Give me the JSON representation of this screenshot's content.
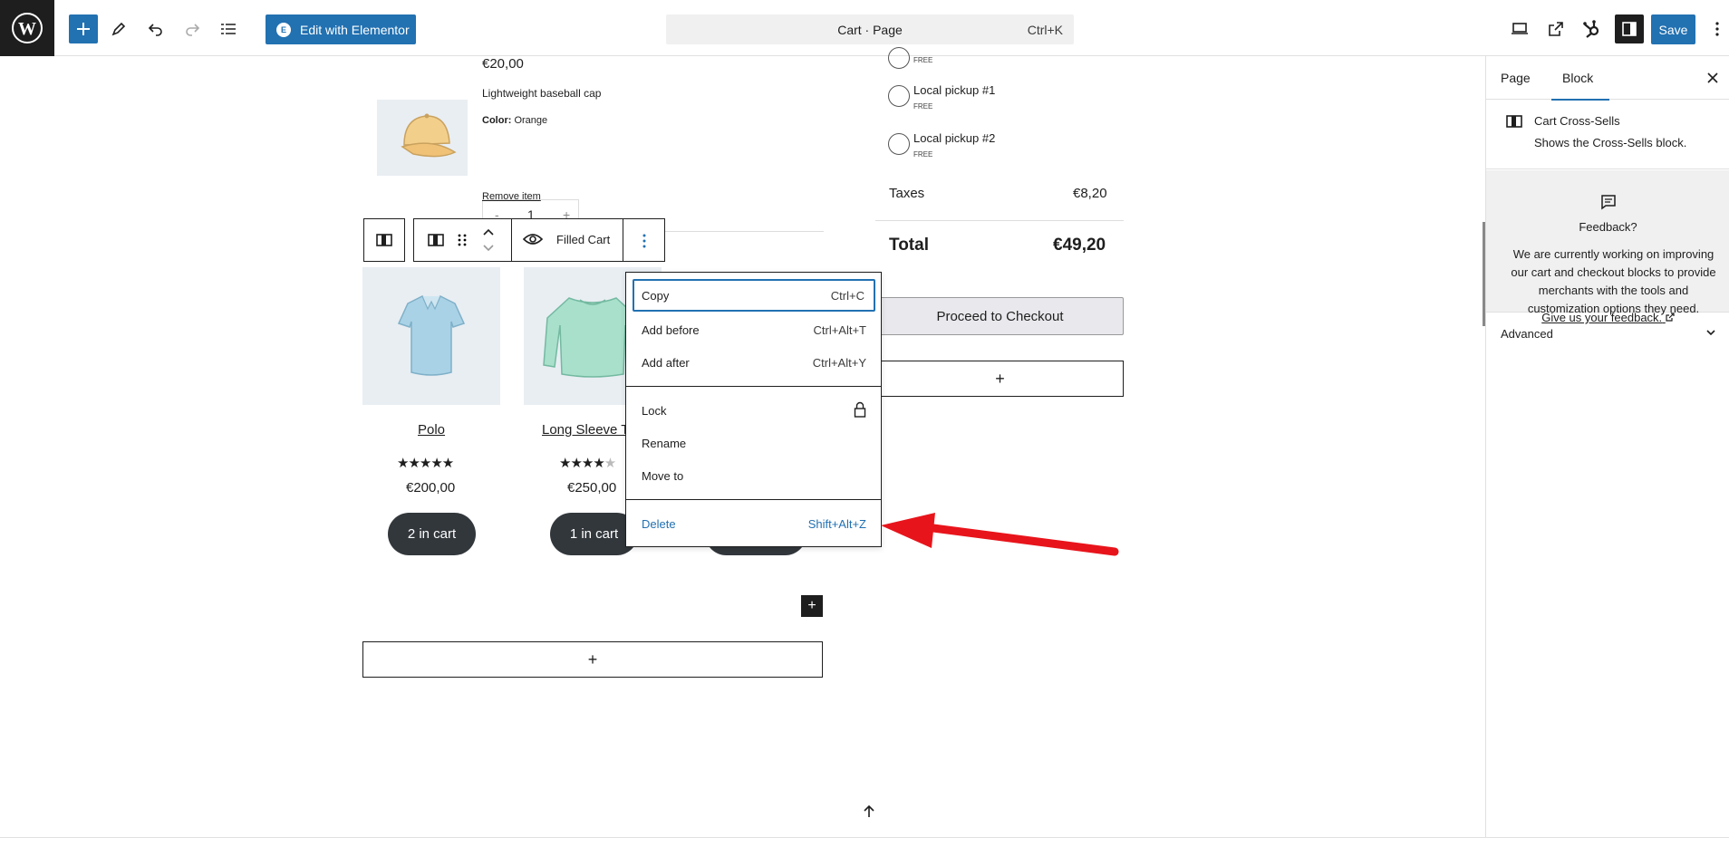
{
  "toolbar": {
    "elementor_label": "Edit with Elementor",
    "elementor_icon_text": "E",
    "document_title": "Cart · Page",
    "command_shortcut": "Ctrl+K",
    "save_label": "Save"
  },
  "sidebar": {
    "tabs": [
      {
        "label": "Page"
      },
      {
        "label": "Block"
      }
    ],
    "active_tab": "Block",
    "block_name": "Cart Cross-Sells",
    "block_description": "Shows the Cross-Sells block.",
    "feedback": {
      "title": "Feedback?",
      "body": "We are currently working on improving our cart and checkout blocks to provide merchants with the tools and customization options they need.",
      "link": "Give us your feedback."
    },
    "advanced_label": "Advanced"
  },
  "cart_item": {
    "price": "€20,00",
    "description": "Lightweight baseball cap",
    "color_label": "Color:",
    "color_value": "Orange",
    "qty_minus": "-",
    "quantity": "1",
    "qty_plus": "+",
    "remove_label": "Remove item"
  },
  "shipping": [
    {
      "label": "",
      "sub": "FREE"
    },
    {
      "label": "Local pickup #1",
      "sub": "FREE"
    },
    {
      "label": "Local pickup #2",
      "sub": "FREE"
    }
  ],
  "totals": {
    "taxes_label": "Taxes",
    "taxes_value": "€8,20",
    "total_label": "Total",
    "total_value": "€49,20",
    "checkout_label": "Proceed to Checkout"
  },
  "block_toolbar": {
    "label": "Filled Cart"
  },
  "context_menu": {
    "items": [
      {
        "label": "Copy",
        "shortcut": "Ctrl+C"
      },
      {
        "label": "Add before",
        "shortcut": "Ctrl+Alt+T"
      },
      {
        "label": "Add after",
        "shortcut": "Ctrl+Alt+Y"
      },
      {
        "label": "Lock",
        "shortcut": ""
      },
      {
        "label": "Rename",
        "shortcut": ""
      },
      {
        "label": "Move to",
        "shortcut": ""
      },
      {
        "label": "Delete",
        "shortcut": "Shift+Alt+Z"
      }
    ]
  },
  "products": [
    {
      "title": "Polo",
      "rating": 4.5,
      "stars": "★★★★★",
      "price": "€200,00",
      "button": "2 in cart"
    },
    {
      "title": "Long Sleeve T",
      "rating": 4.0,
      "stars": "★★★★★",
      "price": "€250,00",
      "button": "1 in cart"
    }
  ],
  "appender_symbol": "+",
  "colors": {
    "accent": "#2271b1",
    "dark": "#1e1e1e",
    "button_dark": "#32373c",
    "arrow": "#e8141b"
  }
}
